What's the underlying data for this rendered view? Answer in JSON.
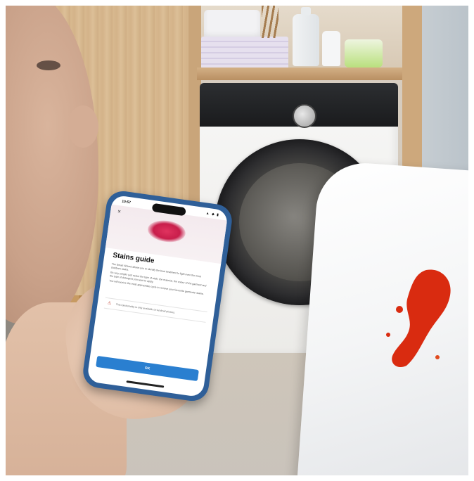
{
  "scene": {
    "description_colors": {
      "stain": "#d92b10",
      "phone_case": "#2f5f98",
      "button": "#2a7fd0"
    }
  },
  "phone": {
    "status_time": "10:57",
    "status_icons": "▲ ◆ ▮",
    "close_label": "×",
    "title": "Stains guide",
    "description": [
      "The Smart Wizard allows you to identify the best treatment to fight even the most stubborn stains.",
      "It's very simple: just select the type of stain, the material, the colour of the garment and the type of detergent you want to apply.",
      "You will receive the most appropriate cycle to remove your favourite garments' stains."
    ],
    "notice_icon": "⚠",
    "notice_text": "This functionality is only available on Android phones.",
    "ok_label": "OK"
  }
}
